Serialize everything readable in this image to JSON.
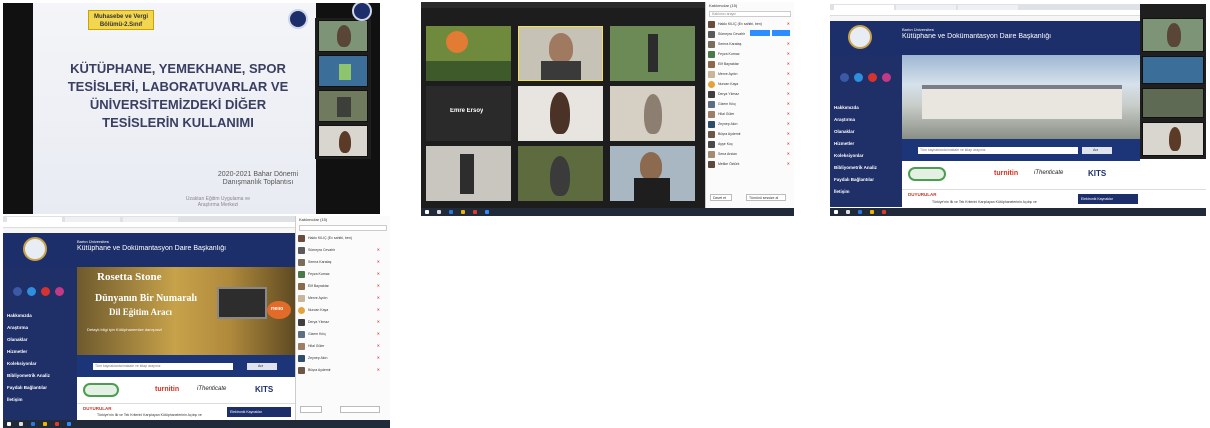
{
  "shot1": {
    "badge_line1": "Muhasebe ve Vergi",
    "badge_line2": "Bölümü-2.Sınıf",
    "title_lines": [
      "KÜTÜPHANE, YEMEKHANE, SPOR",
      "TESİSLERİ, LABORATUVARLAR VE",
      "ÜNİVERSİTEMİZDEKİ DİĞER",
      "TESİSLERİN KULLANIMI"
    ],
    "term": "2020-2021 Bahar Dönemi",
    "meeting": "Danışmanlık Toplantısı",
    "footer1": "Uzaktan Eğitim Uygulama ve",
    "footer2": "Araştırma Merkezi"
  },
  "shot2": {
    "panel_title": "Katılımcılar (15)",
    "search_placeholder": "Katılımcı arayın",
    "center_name": "Emre Ersoy",
    "participants": [
      "Hakkı KILIÇ (Ev sahibi, ben)",
      "Sümeyra Cevahir",
      "Semra Karataş",
      "Feyza Kurnaz",
      "Elif Bayraktar",
      "Merve Aydın",
      "Nurcan Kaya",
      "Derya Yılmaz",
      "Gizem Kılıç",
      "Hilal Güler",
      "Zeynep Akın",
      "Büşra Aydemir",
      "Ayşe Koç",
      "Sena Arslan",
      "Melike Öztürk"
    ],
    "btn_invite": "Davet et",
    "btn_mute": "Tümünü sessize al"
  },
  "shot3": {
    "header_sub": "Bartın Üniversitesi",
    "header_title": "Kütüphane ve Dokümantasyon Daire Başkanlığı",
    "nav": [
      "Hakkımızda",
      "Araştırma",
      "Olanaklar",
      "Hizmetler",
      "Koleksiyonlar",
      "Bibliyometrik Analiz",
      "Faydalı Bağlantılar",
      "İletişim"
    ],
    "search_placeholder": "Tüm kaynaklarda/makale ve kitap arayınız",
    "search_btn": "Ara",
    "logos": [
      "KATALOG TARAMA",
      "turnitin",
      "iThenticate",
      "KITS",
      "AÇIK ARŞİV",
      "UZAK ERİŞİM"
    ],
    "news_title": "DUYURULAR",
    "news_item": "Türkiye'nin İlk ve Tek Kriterini Karşılayan Kütüphanelerinin Açılışı ve",
    "bottom_tab": "Elektronik Kaynaklar"
  },
  "shot4": {
    "banner_brand": "Rosetta Stone",
    "banner_line1": "Dünyanın Bir Numaralı",
    "banner_line2": "Dil Eğitim Aracı",
    "banner_line3": "Detaylı bilgi için Kütüphanemize danışınız!",
    "hello": "Hello"
  },
  "colors": {
    "navy": "#1d2f6b",
    "gold": "#c7a24a",
    "slide_title": "#3a3f62",
    "zoom_dark": "#1d1d1d",
    "mic_red": "#e02020"
  }
}
